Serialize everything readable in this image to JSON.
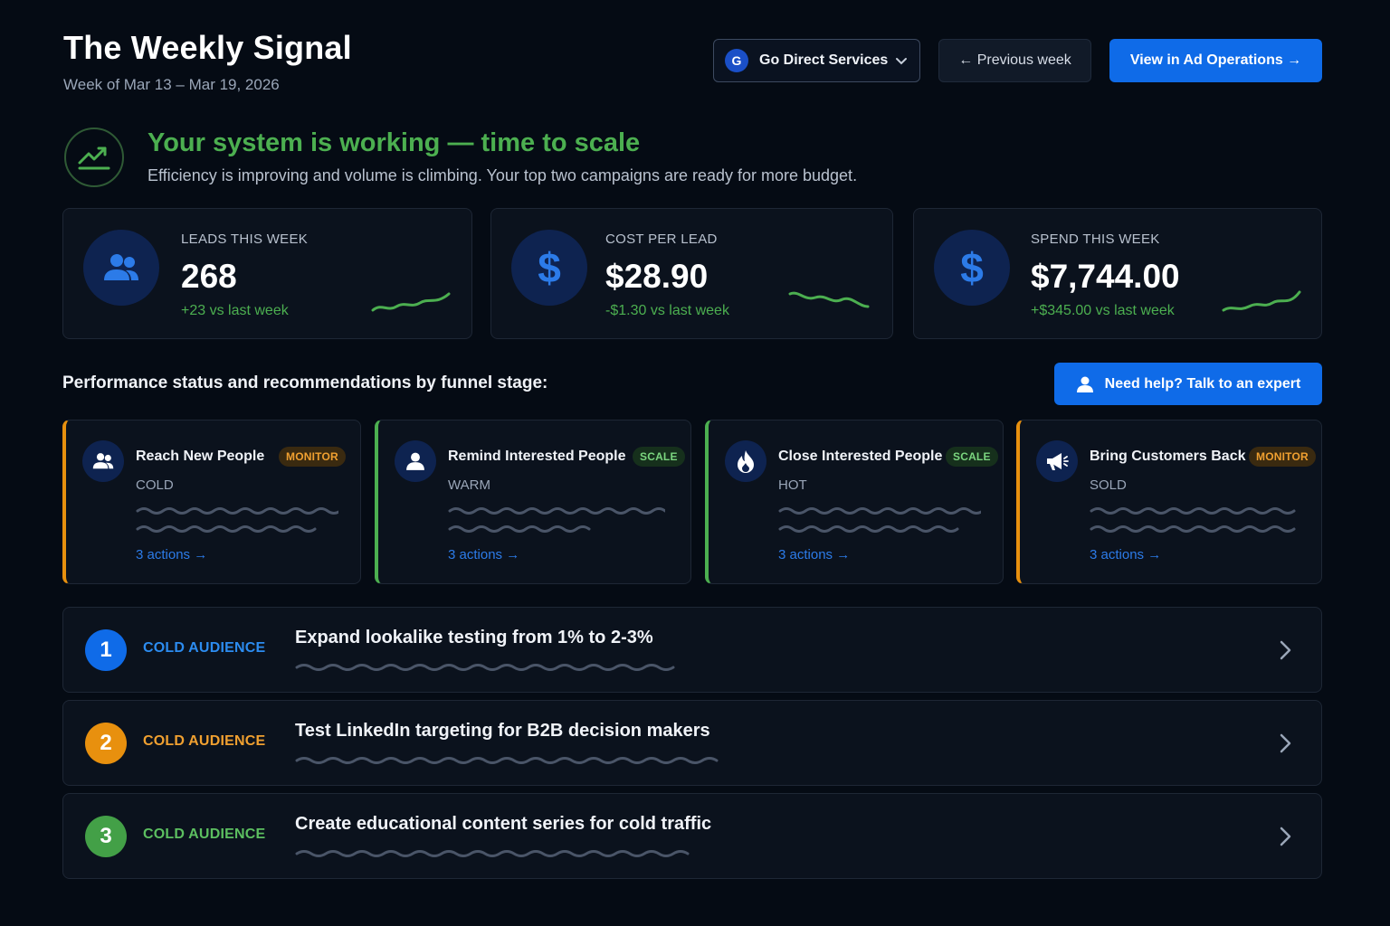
{
  "header": {
    "title": "The Weekly Signal",
    "week": "Week of Mar 13 – Mar 19, 2026",
    "account_initial": "G",
    "account_name": "Go Direct Services",
    "prev_label": "← Previous week",
    "view_label": "View in Ad Operations →"
  },
  "status": {
    "headline": "Your system is working — time to scale",
    "text": "Efficiency is improving and volume is climbing. Your top two campaigns are ready for more budget.",
    "icon": "trending-up-icon",
    "color": "#4caf50"
  },
  "kpis": [
    {
      "label": "LEADS THIS WEEK",
      "value": "268",
      "delta": "+23 vs last week",
      "icon": "users-icon"
    },
    {
      "label": "COST PER LEAD",
      "value": "$28.90",
      "delta": "-$1.30 vs last week",
      "icon": "dollar-icon",
      "icon_glyph": "$"
    },
    {
      "label": "SPEND THIS WEEK",
      "value": "$7,744.00",
      "delta": "+$345.00 vs last week",
      "icon": "dollar-icon",
      "icon_glyph": "$"
    }
  ],
  "funnel": {
    "title": "Performance status and recommendations by funnel stage:",
    "help_label": "Need help? Talk to an expert",
    "stages": [
      {
        "name": "Reach New People",
        "temperature": "COLD",
        "badge": "MONITOR",
        "actions": "3 actions →",
        "icon": "users-icon"
      },
      {
        "name": "Remind Interested People",
        "temperature": "WARM",
        "badge": "SCALE",
        "actions": "3 actions →",
        "icon": "user-icon"
      },
      {
        "name": "Close Interested People",
        "temperature": "HOT",
        "badge": "SCALE",
        "actions": "3 actions →",
        "icon": "flame-icon"
      },
      {
        "name": "Bring Customers Back",
        "temperature": "SOLD",
        "badge": "MONITOR",
        "actions": "3 actions →",
        "icon": "megaphone-icon"
      }
    ]
  },
  "recommendations": [
    {
      "number": "1",
      "audience": "COLD AUDIENCE",
      "title": "Expand lookalike testing from 1% to 2-3%",
      "color": "#0f6be8",
      "audience_color": "#2c8cf0"
    },
    {
      "number": "2",
      "audience": "COLD AUDIENCE",
      "title": "Test LinkedIn targeting for B2B decision makers",
      "color": "#e8900e",
      "audience_color": "#f0a030"
    },
    {
      "number": "3",
      "audience": "COLD AUDIENCE",
      "title": "Create educational content series for cold traffic",
      "color": "#43a047",
      "audience_color": "#5cbf60"
    }
  ],
  "colors": {
    "accent": "#0f6be8",
    "positive": "#4caf50",
    "monitor": "#e8900e",
    "background": "#050b14"
  }
}
